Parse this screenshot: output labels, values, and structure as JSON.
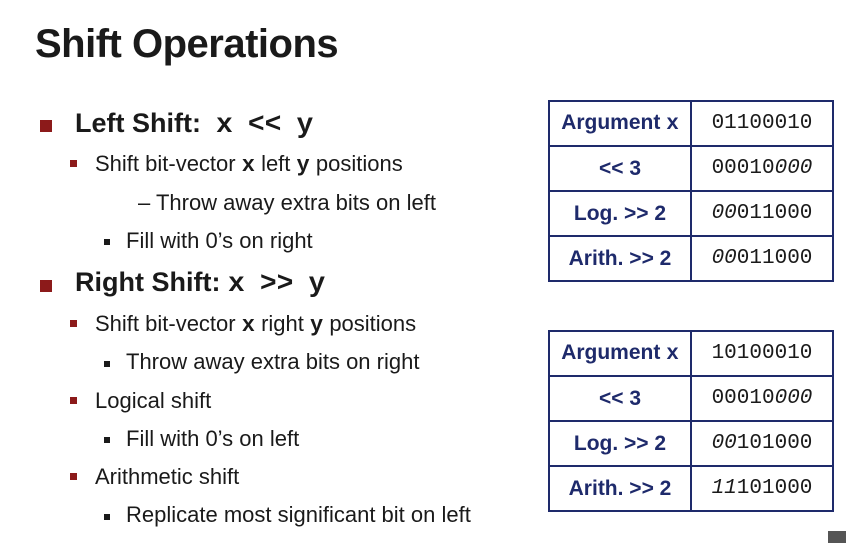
{
  "title": "Shift Operations",
  "left_shift": {
    "heading": "Left Shift:",
    "expr_x": "x",
    "expr_op": "<<",
    "expr_y": "y",
    "sub1_a": "Shift bit-vector",
    "sub1_x": "x",
    "sub1_b": "left",
    "sub1_y": "y",
    "sub1_c": "positions",
    "dash_item": "– Throw away extra bits on left",
    "sub2": "Fill with 0’s on right"
  },
  "right_shift": {
    "heading": "Right Shift:",
    "expr_x": "x",
    "expr_op": ">>",
    "expr_y": "y",
    "sub1_a": "Shift bit-vector",
    "sub1_x": "x",
    "sub1_b": "right",
    "sub1_y": "y",
    "sub1_c": "positions",
    "sub1_detail": "Throw away extra bits on right",
    "logical": "Logical shift",
    "logical_detail": "Fill with 0’s on left",
    "arith": "Arithmetic shift",
    "arith_detail": "Replicate most significant bit on left"
  },
  "tables": [
    {
      "rows": [
        {
          "label": "Argument",
          "label_mono": "x",
          "plain": "01100010",
          "italic": ""
        },
        {
          "label": "<<  3",
          "label_mono": "",
          "plain": "00010",
          "italic": "000"
        },
        {
          "label": "Log. >>  2",
          "label_mono": "",
          "italic": "00",
          "plain": "011000"
        },
        {
          "label": "Arith. >>  2",
          "label_mono": "",
          "italic": "00",
          "plain": "011000"
        }
      ]
    },
    {
      "rows": [
        {
          "label": "Argument",
          "label_mono": "x",
          "plain": "10100010",
          "italic": ""
        },
        {
          "label": "<<  3",
          "label_mono": "",
          "plain": "00010",
          "italic": "000"
        },
        {
          "label": "Log. >>  2",
          "label_mono": "",
          "italic": "00",
          "plain": "101000"
        },
        {
          "label": "Arith. >>  2",
          "label_mono": "",
          "italic": "11",
          "plain": "101000"
        }
      ]
    }
  ]
}
